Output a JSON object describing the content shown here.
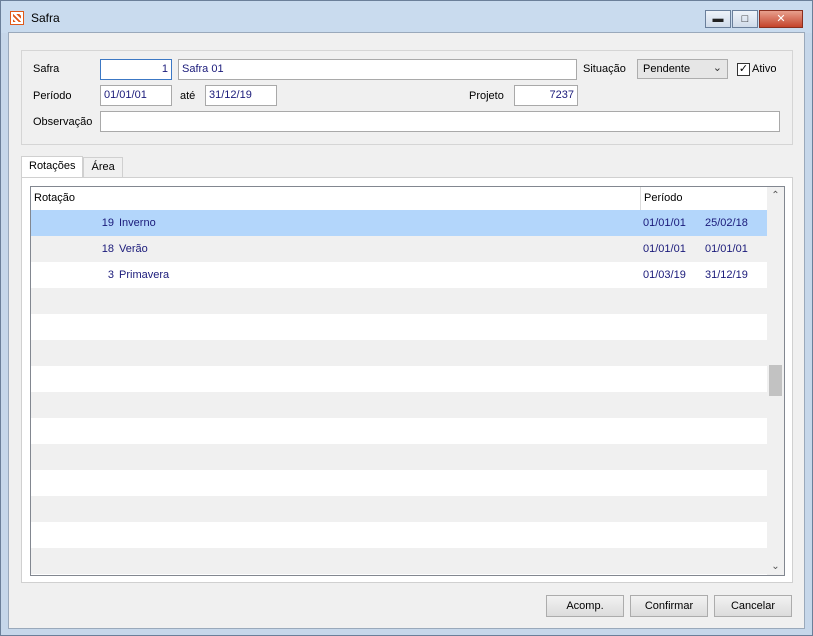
{
  "window": {
    "title": "Safra"
  },
  "form": {
    "safra_label": "Safra",
    "safra_code": "1",
    "safra_name": "Safra 01",
    "situacao_label": "Situação",
    "situacao_value": "Pendente",
    "ativo_label": "Ativo",
    "ativo_checked": true,
    "periodo_label": "Período",
    "periodo_start": "01/01/01",
    "ate_label": "até",
    "periodo_end": "31/12/19",
    "projeto_label": "Projeto",
    "projeto_value": "7237",
    "observacao_label": "Observação",
    "observacao_value": ""
  },
  "tabs": [
    {
      "label": "Rotações",
      "active": true
    },
    {
      "label": "Área",
      "active": false
    }
  ],
  "grid": {
    "columns": [
      "Rotação",
      "Período"
    ],
    "rows": [
      {
        "code": "19",
        "name": "Inverno",
        "start": "01/01/01",
        "end": "25/02/18",
        "selected": true
      },
      {
        "code": "18",
        "name": "Verão",
        "start": "01/01/01",
        "end": "01/01/01",
        "selected": false
      },
      {
        "code": "3",
        "name": "Primavera",
        "start": "01/03/19",
        "end": "31/12/19",
        "selected": false
      }
    ],
    "empty_rows": 11
  },
  "buttons": {
    "acomp": "Acomp.",
    "confirmar": "Confirmar",
    "cancelar": "Cancelar"
  },
  "icons": {
    "app": "app-logo-icon",
    "minimize": "minimize-icon",
    "maximize": "maximize-icon",
    "close": "close-icon",
    "dropdown": "chevron-down-icon",
    "scroll_up": "chevron-up-icon",
    "scroll_down": "chevron-down-icon"
  }
}
